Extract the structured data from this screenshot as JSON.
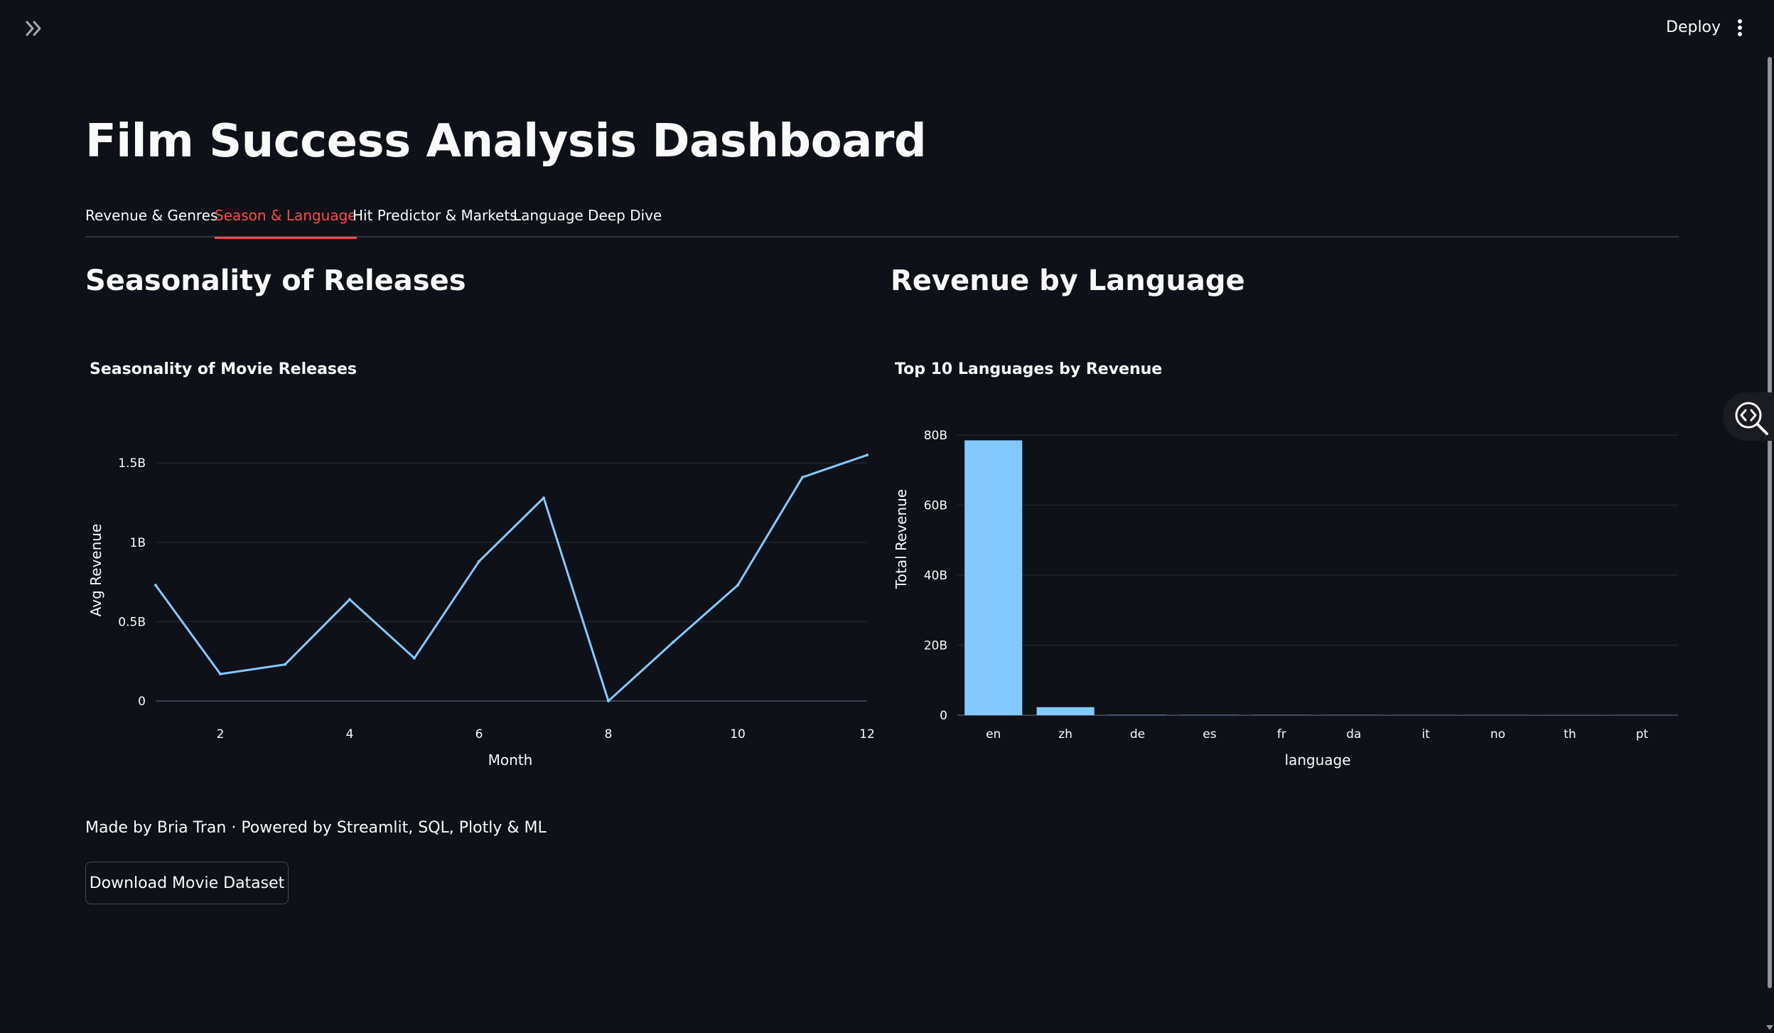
{
  "header": {
    "deploy_label": "Deploy",
    "sidebar_toggle_icon": "double-chevron-right-icon",
    "menu_icon": "vertical-dots-icon"
  },
  "page": {
    "title": "Film Success Analysis Dashboard"
  },
  "tabs": [
    {
      "label": "Revenue & Genres",
      "active": false
    },
    {
      "label": "Season & Language",
      "active": true
    },
    {
      "label": "Hit Predictor & Markets",
      "active": false
    },
    {
      "label": "Language Deep Dive",
      "active": false
    }
  ],
  "sections": {
    "left_header": "Seasonality of Releases",
    "right_header": "Revenue by Language"
  },
  "footer": {
    "credit": "Made by Bria Tran · Powered by Streamlit, SQL, Plotly & ML",
    "download_label": "Download Movie Dataset"
  },
  "colors": {
    "background": "#0e1117",
    "accent": "#ff4b4b",
    "series": "#83c9ff",
    "gridline": "#31333f"
  },
  "chart_data": [
    {
      "type": "line",
      "title": "Seasonality of Movie Releases",
      "xlabel": "Month",
      "ylabel": "Avg Revenue",
      "x": [
        1,
        2,
        3,
        4,
        5,
        6,
        7,
        8,
        9,
        10,
        11,
        12
      ],
      "series": [
        {
          "values": [
            730000000,
            170000000,
            230000000,
            640000000,
            270000000,
            880000000,
            1280000000,
            0,
            370000000,
            730000000,
            1410000000,
            1550000000
          ]
        }
      ],
      "xticks": [
        2,
        4,
        6,
        8,
        10,
        12
      ],
      "xtick_labels": [
        "2",
        "4",
        "6",
        "8",
        "10",
        "12"
      ],
      "yticks": [
        0,
        500000000,
        1000000000,
        1500000000
      ],
      "ytick_labels": [
        "0",
        "0.5B",
        "1B",
        "1.5B"
      ],
      "xlim": [
        1,
        12
      ],
      "ylim": [
        0,
        1640000000
      ],
      "grid": true
    },
    {
      "type": "bar",
      "title": "Top 10 Languages by Revenue",
      "xlabel": "language",
      "ylabel": "Total Revenue",
      "categories": [
        "en",
        "zh",
        "de",
        "es",
        "fr",
        "da",
        "it",
        "no",
        "th",
        "pt"
      ],
      "values": [
        78500000000,
        2300000000,
        70000000,
        50000000,
        40000000,
        30000000,
        20000000,
        15000000,
        10000000,
        8000000
      ],
      "yticks": [
        0,
        20000000000,
        40000000000,
        60000000000,
        80000000000
      ],
      "ytick_labels": [
        "0",
        "20B",
        "40B",
        "60B",
        "80B"
      ],
      "ylim": [
        0,
        80000000000
      ],
      "grid": true
    }
  ]
}
